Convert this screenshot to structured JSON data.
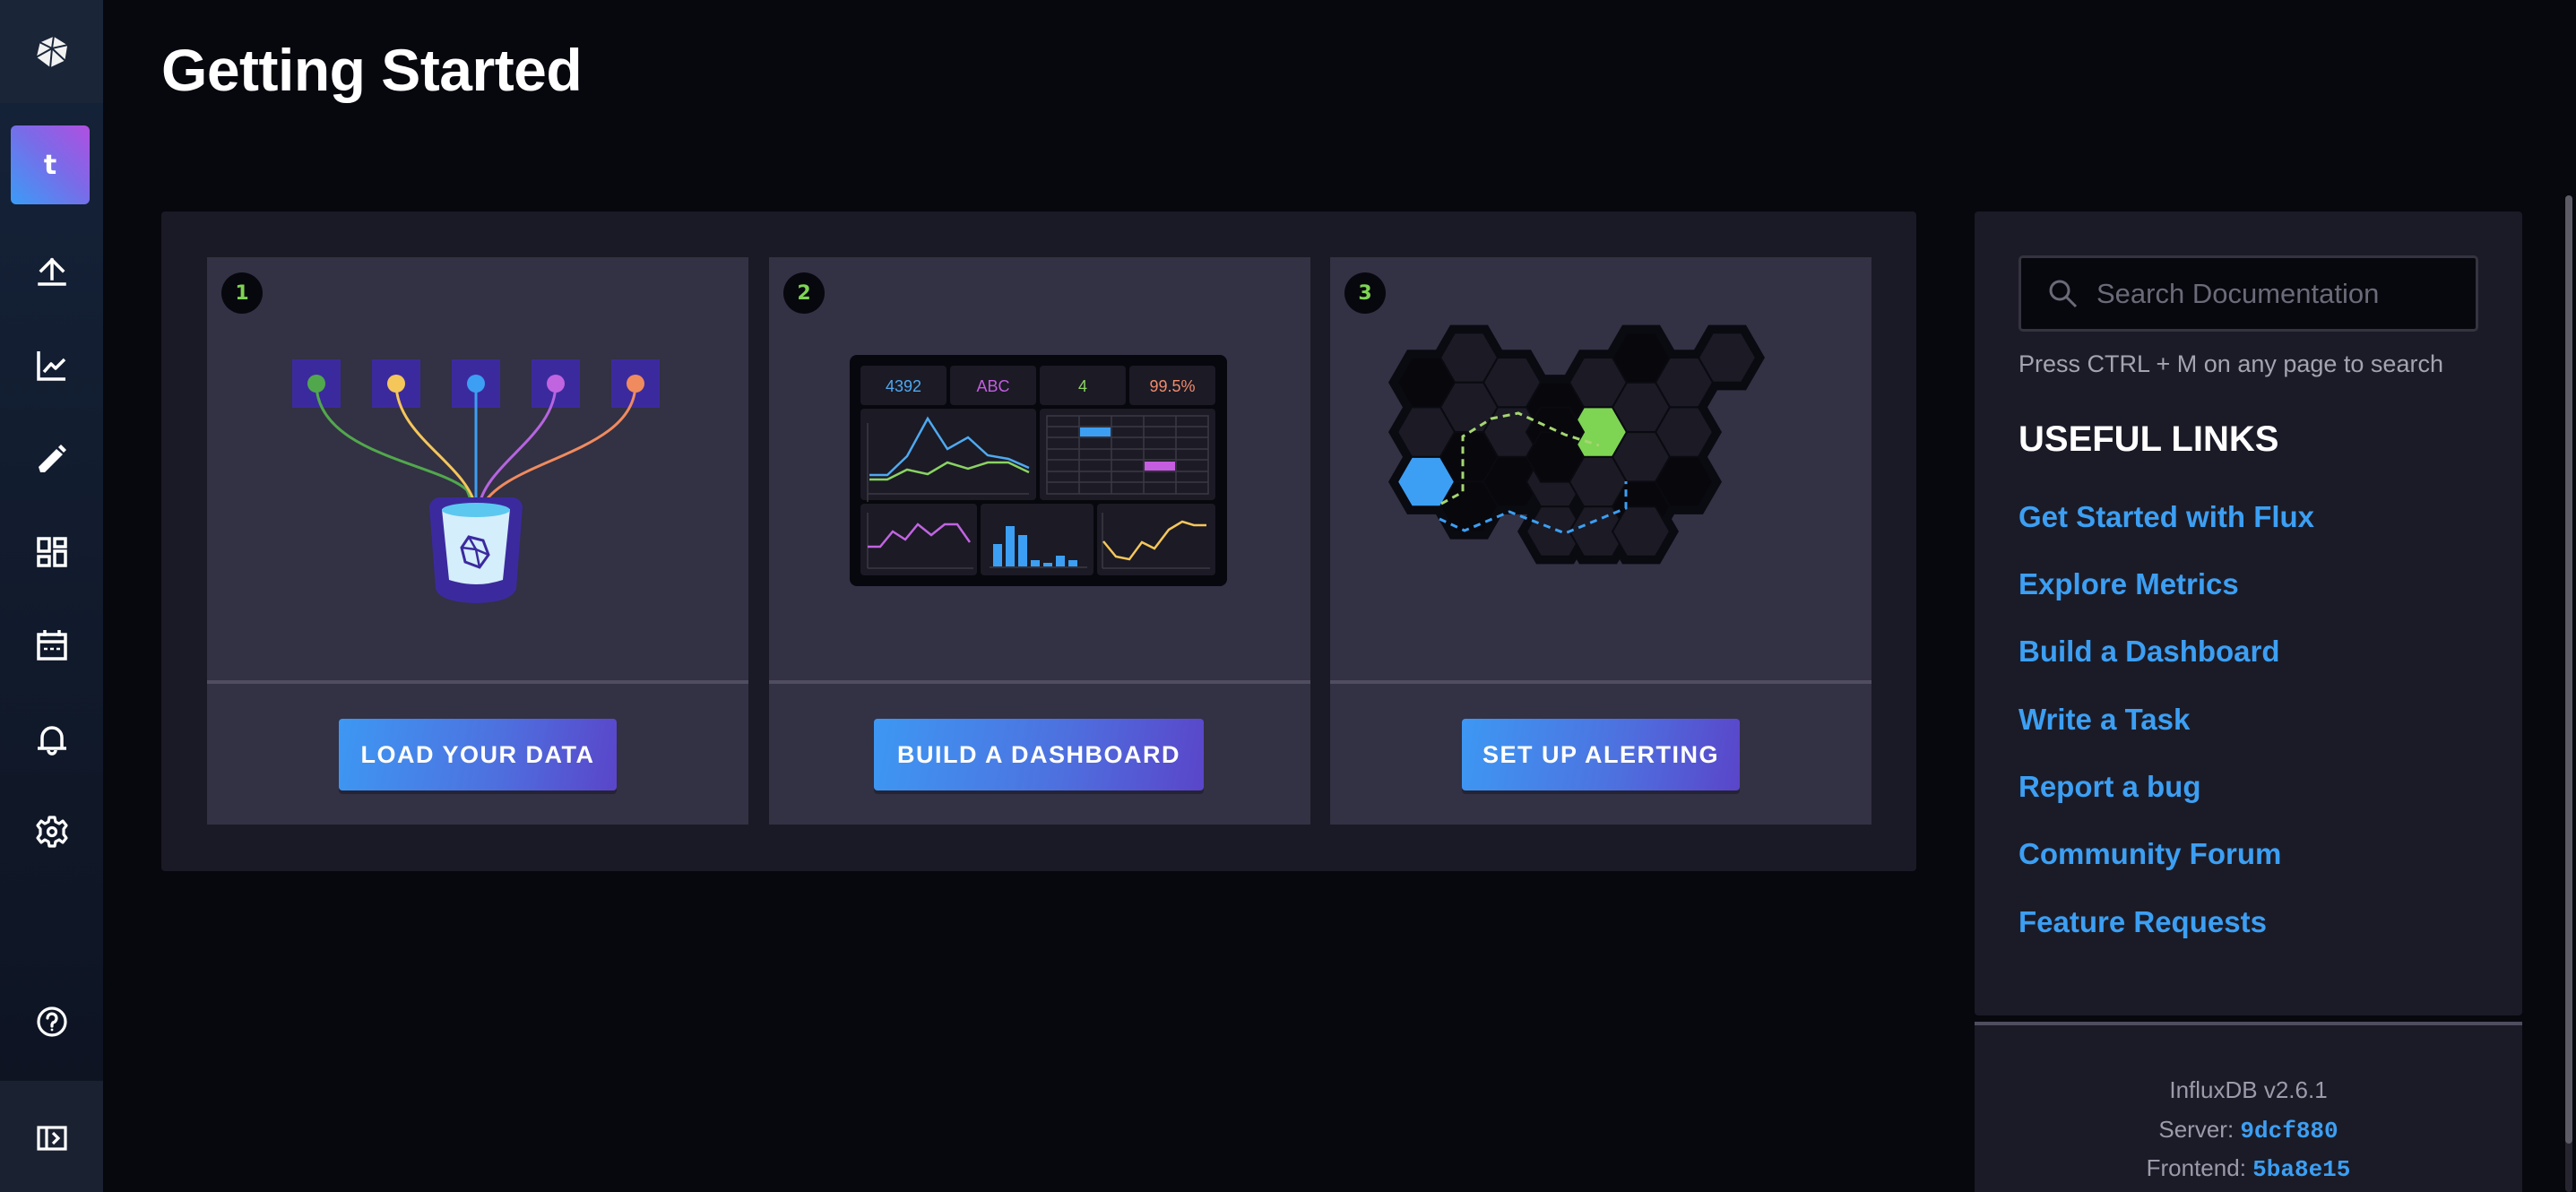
{
  "sidebar": {
    "logo_icon": "influxdb-cube-icon",
    "org_initial": "t",
    "nav": [
      {
        "name": "load-data",
        "icon": "upload-icon"
      },
      {
        "name": "data-explorer",
        "icon": "graph-icon"
      },
      {
        "name": "notebooks",
        "icon": "pencil-icon"
      },
      {
        "name": "dashboards",
        "icon": "dashboard-icon"
      },
      {
        "name": "tasks",
        "icon": "calendar-icon"
      },
      {
        "name": "alerts",
        "icon": "bell-icon"
      },
      {
        "name": "settings",
        "icon": "gear-icon"
      }
    ],
    "help_icon": "help-circle-icon",
    "collapse_icon": "expand-sidebar-icon"
  },
  "page": {
    "title": "Getting Started"
  },
  "cards": [
    {
      "number": "1",
      "button_label": "LOAD YOUR DATA",
      "illustration": "data-sources-into-bucket"
    },
    {
      "number": "2",
      "button_label": "BUILD A DASHBOARD",
      "illustration": "dashboard-preview",
      "dashboard_stats": [
        "4392",
        "ABC",
        "4",
        "99.5%"
      ]
    },
    {
      "number": "3",
      "button_label": "SET UP ALERTING",
      "illustration": "hexagon-alert-map"
    }
  ],
  "docs": {
    "search_placeholder": "Search Documentation",
    "search_value": "",
    "search_hint": "Press CTRL + M on any page to search",
    "links_title": "USEFUL LINKS",
    "links": [
      "Get Started with Flux",
      "Explore Metrics",
      "Build a Dashboard",
      "Write a Task",
      "Report a bug",
      "Community Forum",
      "Feature Requests"
    ]
  },
  "version": {
    "product": "InfluxDB v2.6.1",
    "server_label": "Server:",
    "server_hash": "9dcf880",
    "frontend_label": "Frontend:",
    "frontend_hash": "5ba8e15"
  },
  "colors": {
    "accent_blue": "#3c9ff3",
    "accent_green": "#7ed453",
    "accent_purple": "#b04fe0",
    "stat_colors": [
      "#4fa9f0",
      "#c45ddf",
      "#8ad362",
      "#f08b6c"
    ]
  }
}
